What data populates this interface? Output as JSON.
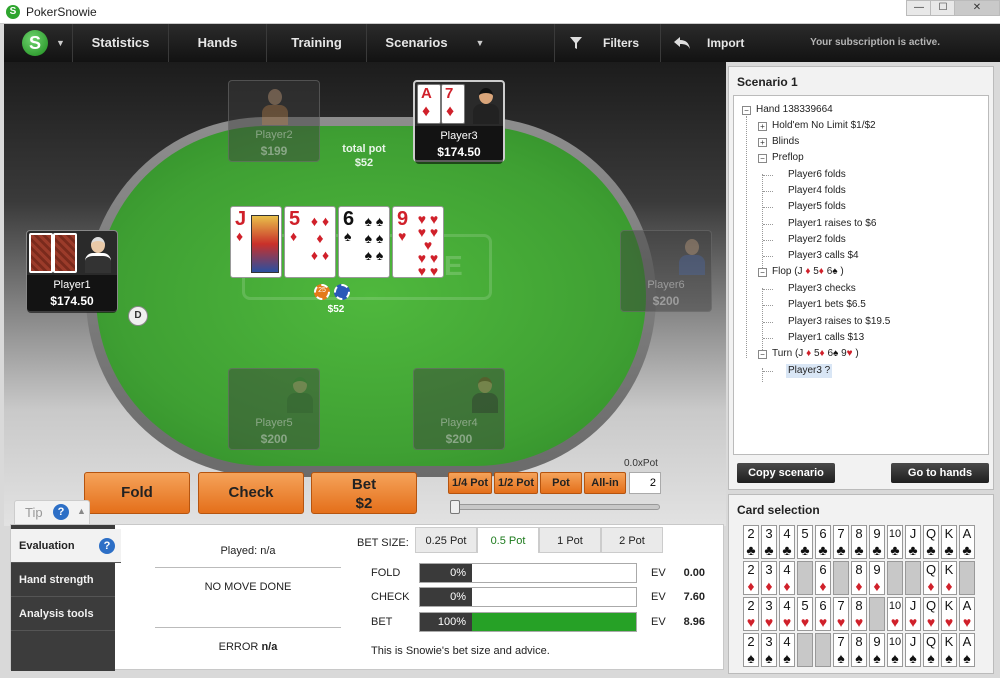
{
  "window": {
    "title": "PokerSnowie",
    "app_icon": "S",
    "minimize": "—",
    "maximize": "☐",
    "close": "✕"
  },
  "menubar": {
    "logo": "S",
    "items": [
      "Statistics",
      "Hands",
      "Training",
      "Scenarios"
    ],
    "filters_label": "Filters",
    "import_label": "Import",
    "subscription_text": "Your subscription is active."
  },
  "table": {
    "total_pot_label": "total pot",
    "total_pot_value": "$52",
    "pot_chips_value": "$52",
    "chip_label": "25",
    "dealer_button": "D",
    "felt_logo_text": "E",
    "board": [
      {
        "rank": "J",
        "suit": "♦",
        "color": "red"
      },
      {
        "rank": "5",
        "suit": "♦",
        "color": "red"
      },
      {
        "rank": "6",
        "suit": "♠",
        "color": "black"
      },
      {
        "rank": "9",
        "suit": "♥",
        "color": "red"
      }
    ],
    "players": [
      {
        "name": "Player2",
        "stack": "$199"
      },
      {
        "name": "Player3",
        "stack": "$174.50",
        "cards": [
          {
            "rank": "A",
            "suit": "♦"
          },
          {
            "rank": "7",
            "suit": "♦"
          }
        ]
      },
      {
        "name": "Player1",
        "stack": "$174.50"
      },
      {
        "name": "Player6",
        "stack": "$200"
      },
      {
        "name": "Player5",
        "stack": "$200"
      },
      {
        "name": "Player4",
        "stack": "$200"
      }
    ]
  },
  "actions": {
    "fold": "Fold",
    "check": "Check",
    "bet_line1": "Bet",
    "bet_line2": "$2",
    "pot_buttons": [
      "1/4 Pot",
      "1/2 Pot",
      "Pot",
      "All-in"
    ],
    "ratio_label": "0.0xPot",
    "bet_amount": "2",
    "slider_position": 0
  },
  "tip": {
    "label": "Tip",
    "help": "?",
    "chevron": "▲"
  },
  "analysis": {
    "nav": [
      "Evaluation",
      "Hand strength",
      "Analysis tools"
    ],
    "played": "Played: n/a",
    "no_move": "NO MOVE DONE",
    "error_label": "ERROR",
    "error_value": "n/a",
    "bet_size_label": "BET SIZE:",
    "bet_size_tabs": [
      "0.25 Pot",
      "0.5 Pot",
      "1 Pot",
      "2 Pot"
    ],
    "selected_tab": "0.5 Pot",
    "ev_label": "EV",
    "rows": [
      {
        "label": "FOLD",
        "pct_text": "0%",
        "pct": 0,
        "ev": "0.00"
      },
      {
        "label": "CHECK",
        "pct_text": "0%",
        "pct": 0,
        "ev": "7.60"
      },
      {
        "label": "BET",
        "pct_text": "100%",
        "pct": 100,
        "ev": "8.96"
      }
    ],
    "advice": "This is Snowie's bet size and advice."
  },
  "scenario": {
    "title": "Scenario 1",
    "tree": {
      "hand": "Hand 138339664",
      "game": "Hold'em No Limit $1/$2",
      "blinds": "Blinds",
      "preflop": "Preflop",
      "preflop_actions": [
        "Player6 folds",
        "Player4 folds",
        "Player5 folds",
        "Player1 raises to $6",
        "Player2 folds",
        "Player3 calls $4"
      ],
      "flop_label": "Flop (J",
      "flop_close": ")",
      "flop_actions": [
        "Player3 checks",
        "Player1 bets $6.5",
        "Player3 raises to $19.5",
        "Player1 calls $13"
      ],
      "turn_label": "Turn (J",
      "turn_close": ")",
      "turn_current": "Player3 ?"
    },
    "copy_button": "Copy scenario",
    "goto_button": "Go to hands"
  },
  "card_selection": {
    "title": "Card selection",
    "ranks": [
      "2",
      "3",
      "4",
      "5",
      "6",
      "7",
      "8",
      "9",
      "10",
      "J",
      "Q",
      "K",
      "A"
    ],
    "suits": [
      {
        "symbol": "♣",
        "color": "#111",
        "used": []
      },
      {
        "symbol": "♦",
        "color": "#d0202a",
        "used": [
          "5",
          "7",
          "10",
          "J",
          "A"
        ]
      },
      {
        "symbol": "♥",
        "color": "#d0202a",
        "used": [
          "9"
        ]
      },
      {
        "symbol": "♠",
        "color": "#111",
        "used": [
          "5",
          "6"
        ]
      }
    ]
  }
}
